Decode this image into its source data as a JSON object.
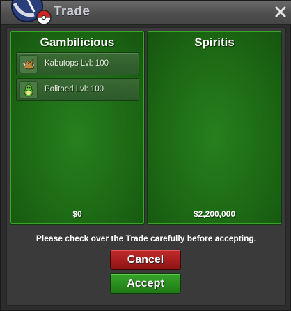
{
  "window": {
    "title": "Trade",
    "close_icon": "close-icon",
    "logo_icon": "pokeball-logo-icon"
  },
  "left_panel": {
    "player_name": "Gambilicious",
    "money": "$0",
    "pokemon": [
      {
        "label": "Kabutops  Lvl: 100",
        "icon": "kabutops-sprite-icon"
      },
      {
        "label": "Politoed  Lvl: 100",
        "icon": "politoed-sprite-icon"
      }
    ]
  },
  "right_panel": {
    "player_name": "Spiritis",
    "money": "$2,200,000",
    "pokemon": []
  },
  "notice": "Please check over the Trade carefully before accepting.",
  "buttons": {
    "cancel_label": "Cancel",
    "accept_label": "Accept"
  },
  "colors": {
    "panel_green": "#1d6a15",
    "cancel_red": "#a81f1f",
    "accept_green": "#2a8f1f",
    "title_text": "#c9ccd6"
  }
}
